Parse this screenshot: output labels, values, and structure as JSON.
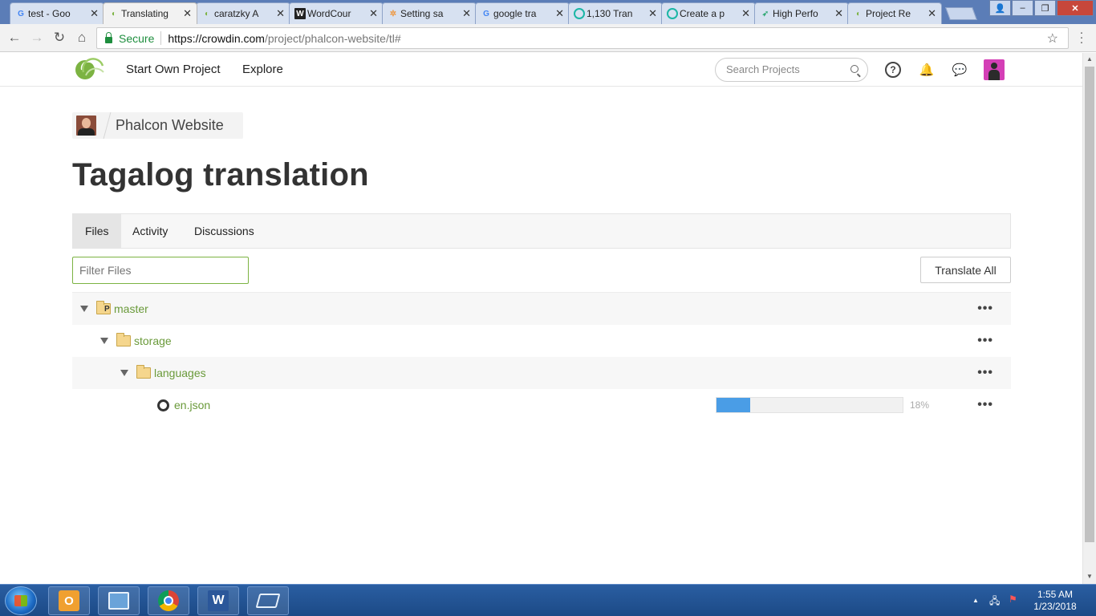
{
  "browser": {
    "tabs": [
      {
        "title": "test - Goo",
        "favicon": "G",
        "color": "#4285f4"
      },
      {
        "title": "Translating",
        "favicon": "crowdin",
        "color": "#7cb342"
      },
      {
        "title": "caratzky A",
        "favicon": "crowdin",
        "color": "#7cb342"
      },
      {
        "title": "WordCour",
        "favicon": "W",
        "color": "#222"
      },
      {
        "title": "Setting sa",
        "favicon": "pinwheel",
        "color": "#e94"
      },
      {
        "title": "google tra",
        "favicon": "G",
        "color": "#4285f4"
      },
      {
        "title": "1,130 Tran",
        "favicon": "circle",
        "color": "#1bb6a6"
      },
      {
        "title": "Create a p",
        "favicon": "circle",
        "color": "#1bb6a6"
      },
      {
        "title": "High Perfo",
        "favicon": "bird",
        "color": "#3a7"
      },
      {
        "title": "Project Re",
        "favicon": "crowdin",
        "color": "#7cb342"
      }
    ],
    "tab_close_glyph": "✕",
    "active_tab_index": 1,
    "secure_label": "Secure",
    "url_host": "https://crowdin.com",
    "url_path": "/project/phalcon-website/tl#"
  },
  "site_header": {
    "nav": [
      "Start Own Project",
      "Explore"
    ],
    "search_placeholder": "Search Projects",
    "help_glyph": "?",
    "bell_glyph": "🔔",
    "chat_glyph": "💬"
  },
  "breadcrumb": {
    "project_name": "Phalcon Website"
  },
  "page_title": "Tagalog translation",
  "tabs": [
    "Files",
    "Activity",
    "Discussions"
  ],
  "active_tab": "Files",
  "filter_placeholder": "Filter Files",
  "translate_all_label": "Translate All",
  "tree": {
    "rows": [
      {
        "name": "master",
        "type": "branch",
        "branch_mark": "P",
        "menu": "•••"
      },
      {
        "name": "storage",
        "type": "folder",
        "menu": "•••"
      },
      {
        "name": "languages",
        "type": "folder",
        "menu": "•••"
      },
      {
        "name": "en.json",
        "type": "file",
        "progress": 0.18,
        "progress_label": "18%",
        "menu": "•••"
      }
    ]
  },
  "taskbar": {
    "outlook_glyph": "O",
    "word_glyph": "W",
    "tray_up_glyph": "▲",
    "time": "1:55 AM",
    "date": "1/23/2018"
  },
  "window_controls": {
    "minimize": "–",
    "maximize": "❐",
    "close": "✕"
  },
  "colors": {
    "accent_green": "#7cb342",
    "progress_blue": "#4a9de6"
  }
}
